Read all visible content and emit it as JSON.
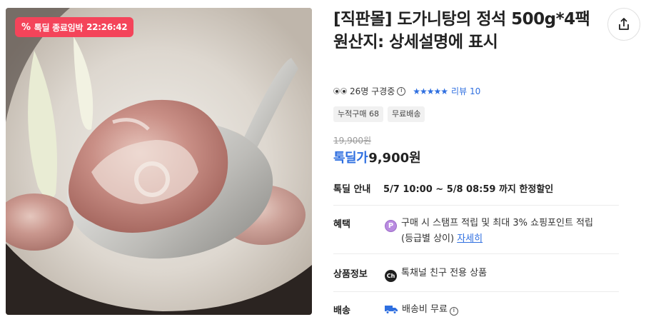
{
  "badge": {
    "label": "톡딜 종료임박",
    "countdown": "22:26:42"
  },
  "product": {
    "title": "[직판몰] 도가니탕의 정석 500g*4팩 원산지: 상세설명에 표시"
  },
  "meta": {
    "viewers": "26명 구경중",
    "rating_stars": 5,
    "review_label": "리뷰 10"
  },
  "chips": [
    "누적구매 68",
    "무료배송"
  ],
  "price": {
    "original": "19,900원",
    "sale_label": "톡딜가",
    "sale": "9,900원"
  },
  "deal": {
    "label": "톡딜 안내",
    "period": "5/7 10:00 ~ 5/8 08:59 까지 한정할인"
  },
  "benefit": {
    "label": "혜택",
    "icon_letter": "P",
    "text": "구매 시 스탬프 적립 및 최대 3% 쇼핑포인트 적립",
    "text2": "(등급별 상이)",
    "link": "자세히"
  },
  "product_info": {
    "label": "상품정보",
    "icon_text": "Ch",
    "text": "톡채널 친구 전용 상품"
  },
  "shipping": {
    "label": "배송",
    "text": "배송비 무료"
  },
  "colors": {
    "badge_red": "#f4445a",
    "accent_blue": "#2f6fe0"
  },
  "icons": [
    "percent-icon",
    "share-icon",
    "info-icon",
    "star-icon",
    "point-icon",
    "channel-icon",
    "truck-icon"
  ]
}
